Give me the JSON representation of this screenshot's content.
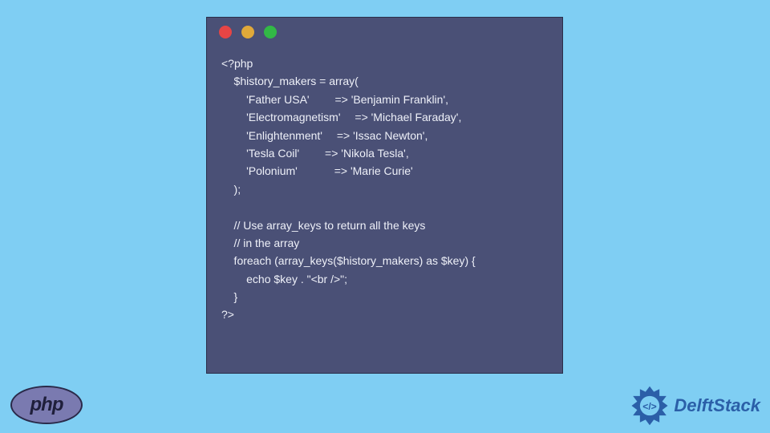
{
  "window": {
    "colors": {
      "red": "#e64545",
      "yellow": "#e0a93a",
      "green": "#32b846"
    }
  },
  "code": {
    "line1": "<?php",
    "line2": "    $history_makers = array(",
    "line3": "        'Father USA'   => 'Benjamin Franklin',",
    "line4": "        'Electromagnetism'  => 'Michael Faraday',",
    "line5": "        'Enlightenment'  => 'Issac Newton',",
    "line6": "        'Tesla Coil'   => 'Nikola Tesla',",
    "line7": "        'Polonium'    => 'Marie Curie'",
    "line8": "    );",
    "line9": "",
    "line10": "    // Use array_keys to return all the keys",
    "line11": "    // in the array",
    "line12": "    foreach (array_keys($history_makers) as $key) {",
    "line13": "        echo $key . \"<br />\";",
    "line14": "    }",
    "line15": "?>"
  },
  "php_label": "php",
  "brand": "DelftStack"
}
